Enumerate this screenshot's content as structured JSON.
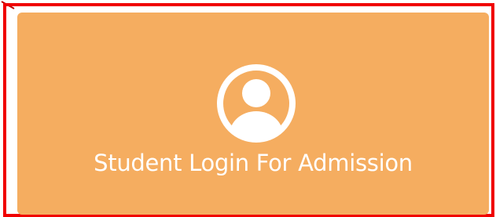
{
  "login_tile": {
    "label": "Student Login For Admission",
    "icon": "user-circle-icon",
    "background_color": "#f5ad60",
    "text_color": "#ffffff"
  },
  "highlight": {
    "border_color": "#f00000"
  }
}
